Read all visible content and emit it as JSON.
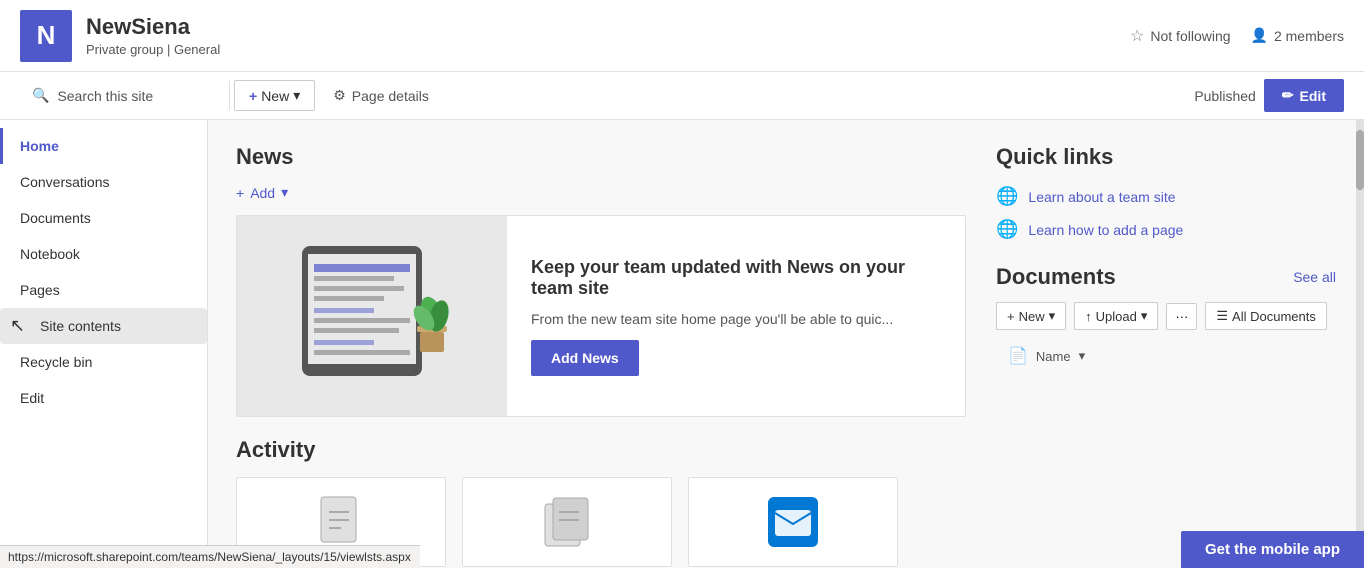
{
  "header": {
    "icon_letter": "N",
    "site_name": "NewSiena",
    "site_type": "Private group",
    "site_section": "General",
    "not_following_label": "Not following",
    "members_count": "2 members"
  },
  "toolbar": {
    "search_placeholder": "Search this site",
    "new_label": "New",
    "page_details_label": "Page details",
    "published_label": "Published",
    "edit_label": "Edit"
  },
  "sidebar": {
    "items": [
      {
        "label": "Home",
        "active": true
      },
      {
        "label": "Conversations",
        "active": false
      },
      {
        "label": "Documents",
        "active": false
      },
      {
        "label": "Notebook",
        "active": false
      },
      {
        "label": "Pages",
        "active": false
      },
      {
        "label": "Site contents",
        "active": false,
        "highlighted": true
      },
      {
        "label": "Recycle bin",
        "active": false
      },
      {
        "label": "Edit",
        "active": false
      }
    ]
  },
  "news": {
    "title": "News",
    "add_label": "Add",
    "heading": "Keep your team updated with News on your team site",
    "description": "From the new team site home page you'll be able to quic...",
    "add_news_label": "Add News"
  },
  "activity": {
    "title": "Activity"
  },
  "quick_links": {
    "title": "Quick links",
    "items": [
      {
        "label": "Learn about a team site"
      },
      {
        "label": "Learn how to add a page"
      }
    ]
  },
  "documents": {
    "title": "Documents",
    "see_all_label": "See all",
    "new_label": "New",
    "upload_label": "Upload",
    "all_docs_label": "All Documents",
    "name_col_label": "Name"
  },
  "mobile_banner": {
    "label": "Get the mobile app"
  },
  "url_bar": {
    "url": "https://microsoft.sharepoint.com/teams/NewSiena/_layouts/15/viewlsts.aspx"
  }
}
